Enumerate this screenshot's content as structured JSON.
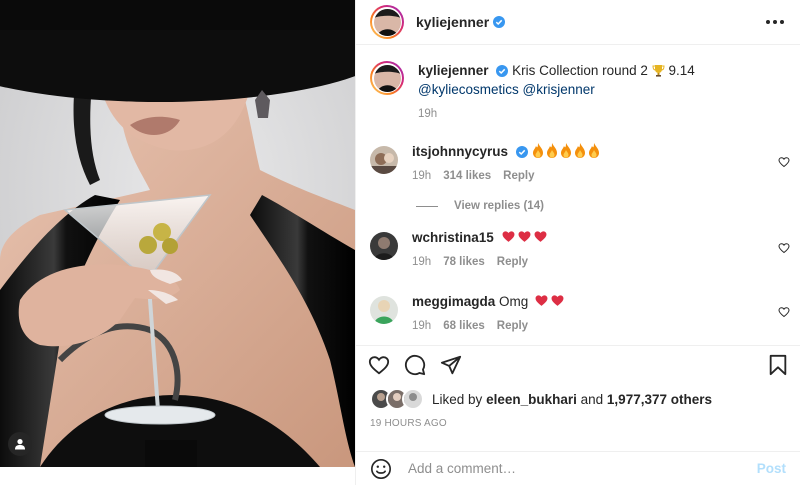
{
  "colors": {
    "text": "#262626",
    "muted": "#8e8e8e",
    "link": "#00376b",
    "verified": "#3897f0",
    "heart": "#ed4956",
    "post_disabled": "#b2dffc"
  },
  "header": {
    "username": "kyliejenner",
    "verified_icon": "verified-badge-icon",
    "more_icon": "more-options-icon"
  },
  "caption": {
    "username": "kyliejenner",
    "text_before": "Kris Collection round 2",
    "text_after": "9.14",
    "mention1": "@kyliecosmetics",
    "mention2": "@krisjenner",
    "time": "19h"
  },
  "comments": [
    {
      "username": "itsjohnnycyrus",
      "verified": true,
      "emoji": "fire x5",
      "time": "19h",
      "likes": "314 likes",
      "reply": "Reply",
      "view_replies": "View replies (14)"
    },
    {
      "username": "wchristina15",
      "verified": false,
      "emoji": "red heart x3",
      "time": "19h",
      "likes": "78 likes",
      "reply": "Reply"
    },
    {
      "username": "meggimagda",
      "verified": false,
      "text": "Omg",
      "emoji": "red heart x2",
      "time": "19h",
      "likes": "68 likes",
      "reply": "Reply"
    }
  ],
  "likes": {
    "prefix": "Liked by",
    "user": "eleen_bukhari",
    "and": "and",
    "others": "1,977,377 others"
  },
  "timestamp": "19 HOURS AGO",
  "add_comment": {
    "placeholder": "Add a comment…",
    "post_label": "Post"
  }
}
